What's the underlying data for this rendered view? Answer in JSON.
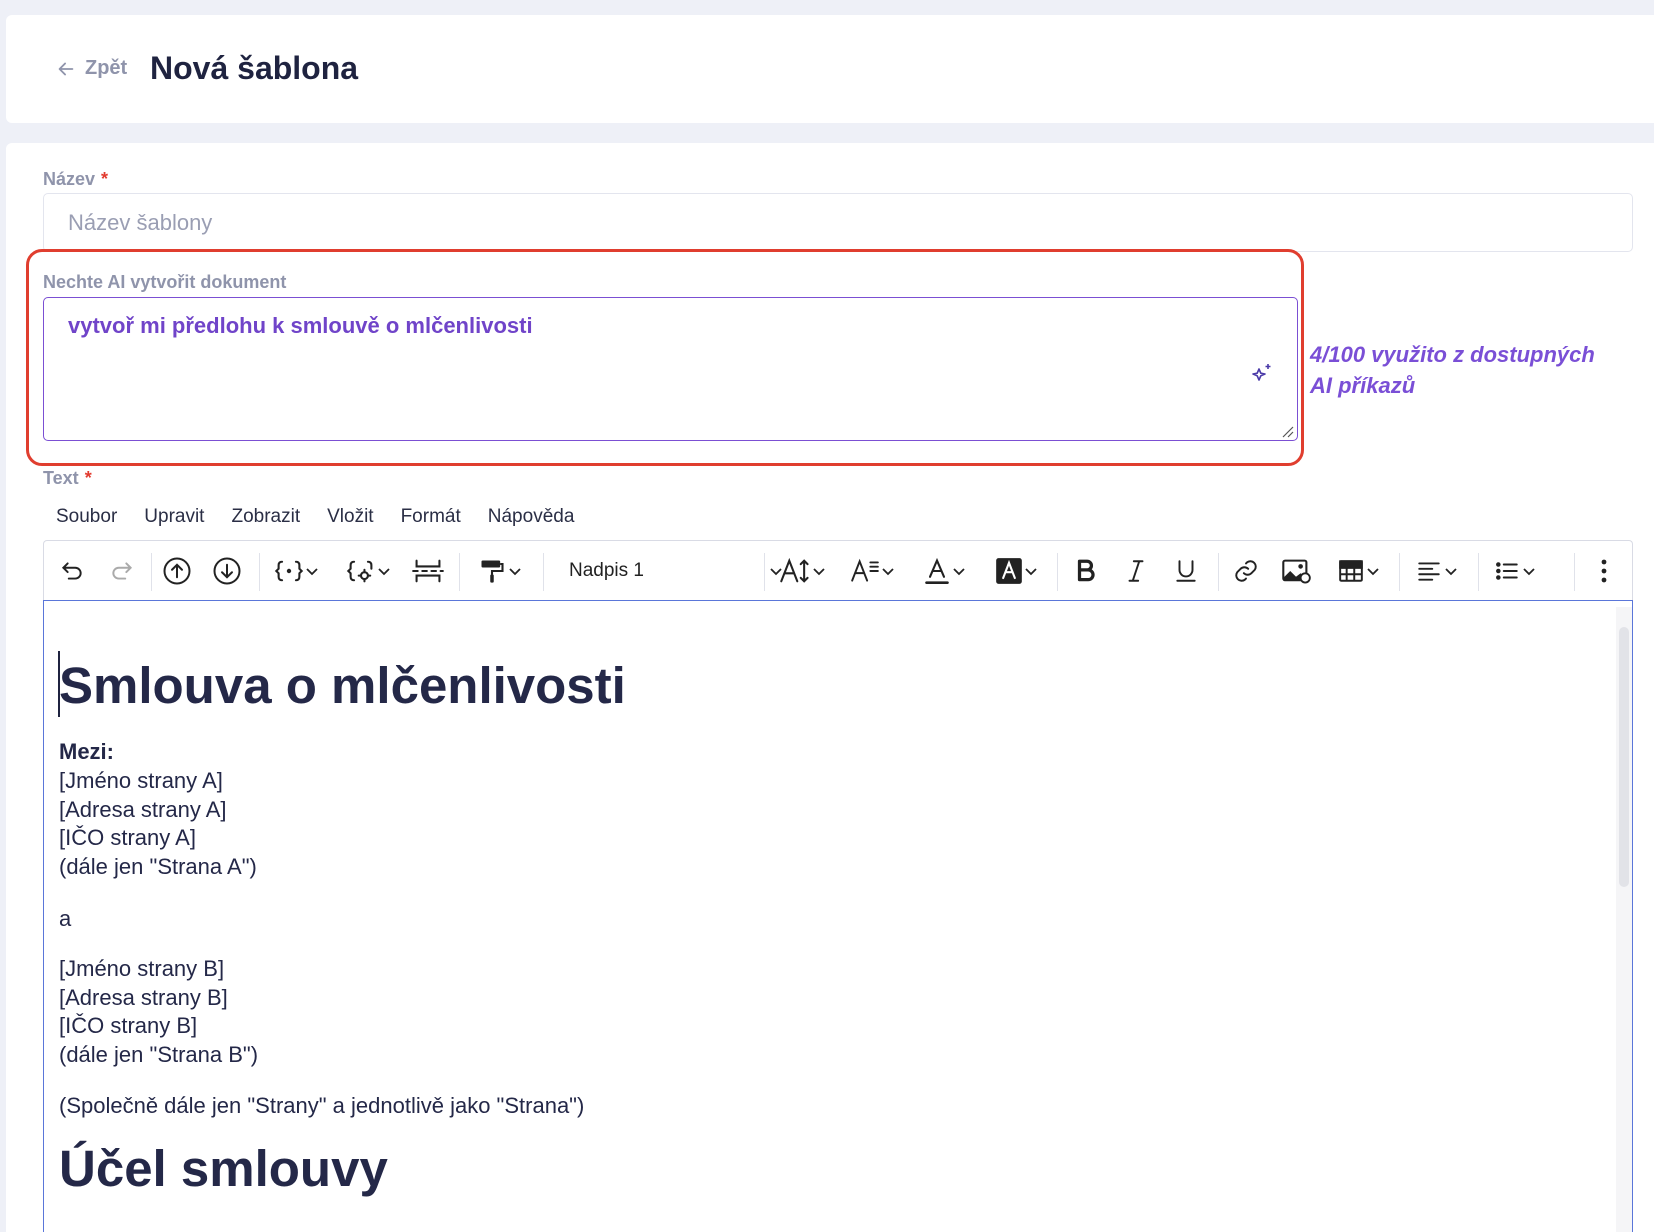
{
  "header": {
    "back_label": "Zpět",
    "title": "Nová šablona"
  },
  "form": {
    "name_label": "Název",
    "name_placeholder": "Název šablony",
    "ai_label": "Nechte AI vytvořit dokument",
    "ai_prompt_value": "vytvoř mi předlohu k smlouvě o mlčenlivosti",
    "ai_usage_line1": "4/100 využito z dostupných",
    "ai_usage_line2": "AI příkazů",
    "text_label": "Text",
    "required_mark": "*"
  },
  "editor": {
    "menu": [
      "Soubor",
      "Upravit",
      "Zobrazit",
      "Vložit",
      "Formát",
      "Nápověda"
    ],
    "block_style": "Nadpis 1",
    "content": {
      "heading1": "Smlouva o mlčenlivosti",
      "between_label": "Mezi:",
      "party_a": [
        "[Jméno strany A]",
        "[Adresa strany A]",
        "[IČO strany A]",
        "(dále jen \"Strana A\")"
      ],
      "conjunction": "a",
      "party_b": [
        "[Jméno strany B]",
        "[Adresa strany B]",
        "[IČO strany B]",
        "(dále jen \"Strana B\")"
      ],
      "parties_note": "(Společně dále jen \"Strany\" a jednotlivě jako \"Strana\")",
      "heading2": "Účel smlouvy"
    }
  },
  "colors": {
    "accent_purple": "#7a4fd6",
    "highlight_red": "#e03e2f",
    "required_red": "#e23a2e",
    "label_gray": "#8f94ab",
    "heading_navy": "#242848"
  }
}
